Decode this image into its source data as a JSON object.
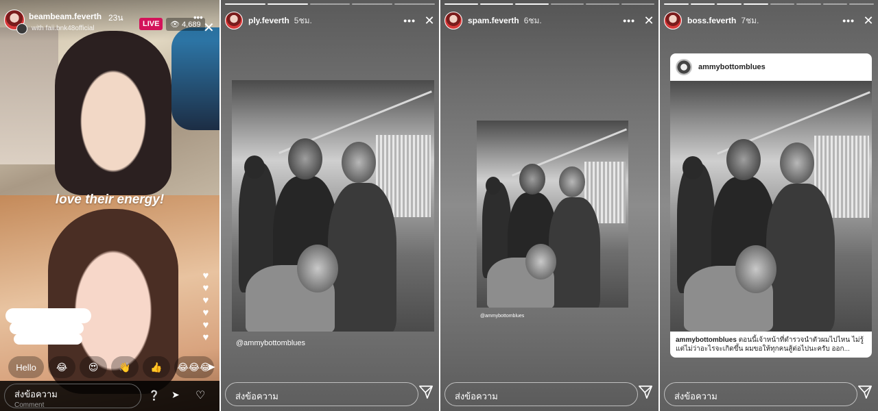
{
  "panels": {
    "live": {
      "username": "beambeam.feverth",
      "time": "23น",
      "with_text": "with faii.bnk48official",
      "live_badge": "LIVE",
      "viewers": "4,689",
      "sticker_text": "love their energy!",
      "reactions": [
        {
          "label": "Hello",
          "icon": ""
        },
        {
          "label": "",
          "icon": "😂"
        },
        {
          "label": "",
          "icon": "😍"
        },
        {
          "label": "",
          "icon": "👋"
        },
        {
          "label": "",
          "icon": "👍"
        },
        {
          "label": "",
          "icon": "😂😂😂"
        }
      ],
      "input_label": "ส่งข้อความ",
      "input_placeholder": "Comment",
      "more_icon": "more-icon",
      "close_icon": "close-icon"
    },
    "story2": {
      "username": "ply.feverth",
      "time": "5ชม.",
      "photo_credit": "@ammybottomblues",
      "input_label": "ส่งข้อความ"
    },
    "story3": {
      "username": "spam.feverth",
      "time": "6ชม.",
      "photo_credit": "@ammybottomblues",
      "input_label": "ส่งข้อความ"
    },
    "story4": {
      "username": "boss.feverth",
      "time": "7ชม.",
      "post_username": "ammybottomblues",
      "post_caption_user": "ammybottomblues",
      "post_caption_text": "ตอนนี้เจ้าหน้าที่ตำรวจนำตัวผมไปไหน ไม่รู้ แต่ไม่ว่าอะไรจะเกิดขึ้น ผมขอให้ทุกคนสู้ต่อไปนะครับ ออก...",
      "input_label": "ส่งข้อความ"
    }
  },
  "colors": {
    "live_badge": "#d3135a",
    "story_text": "#ffffff"
  }
}
